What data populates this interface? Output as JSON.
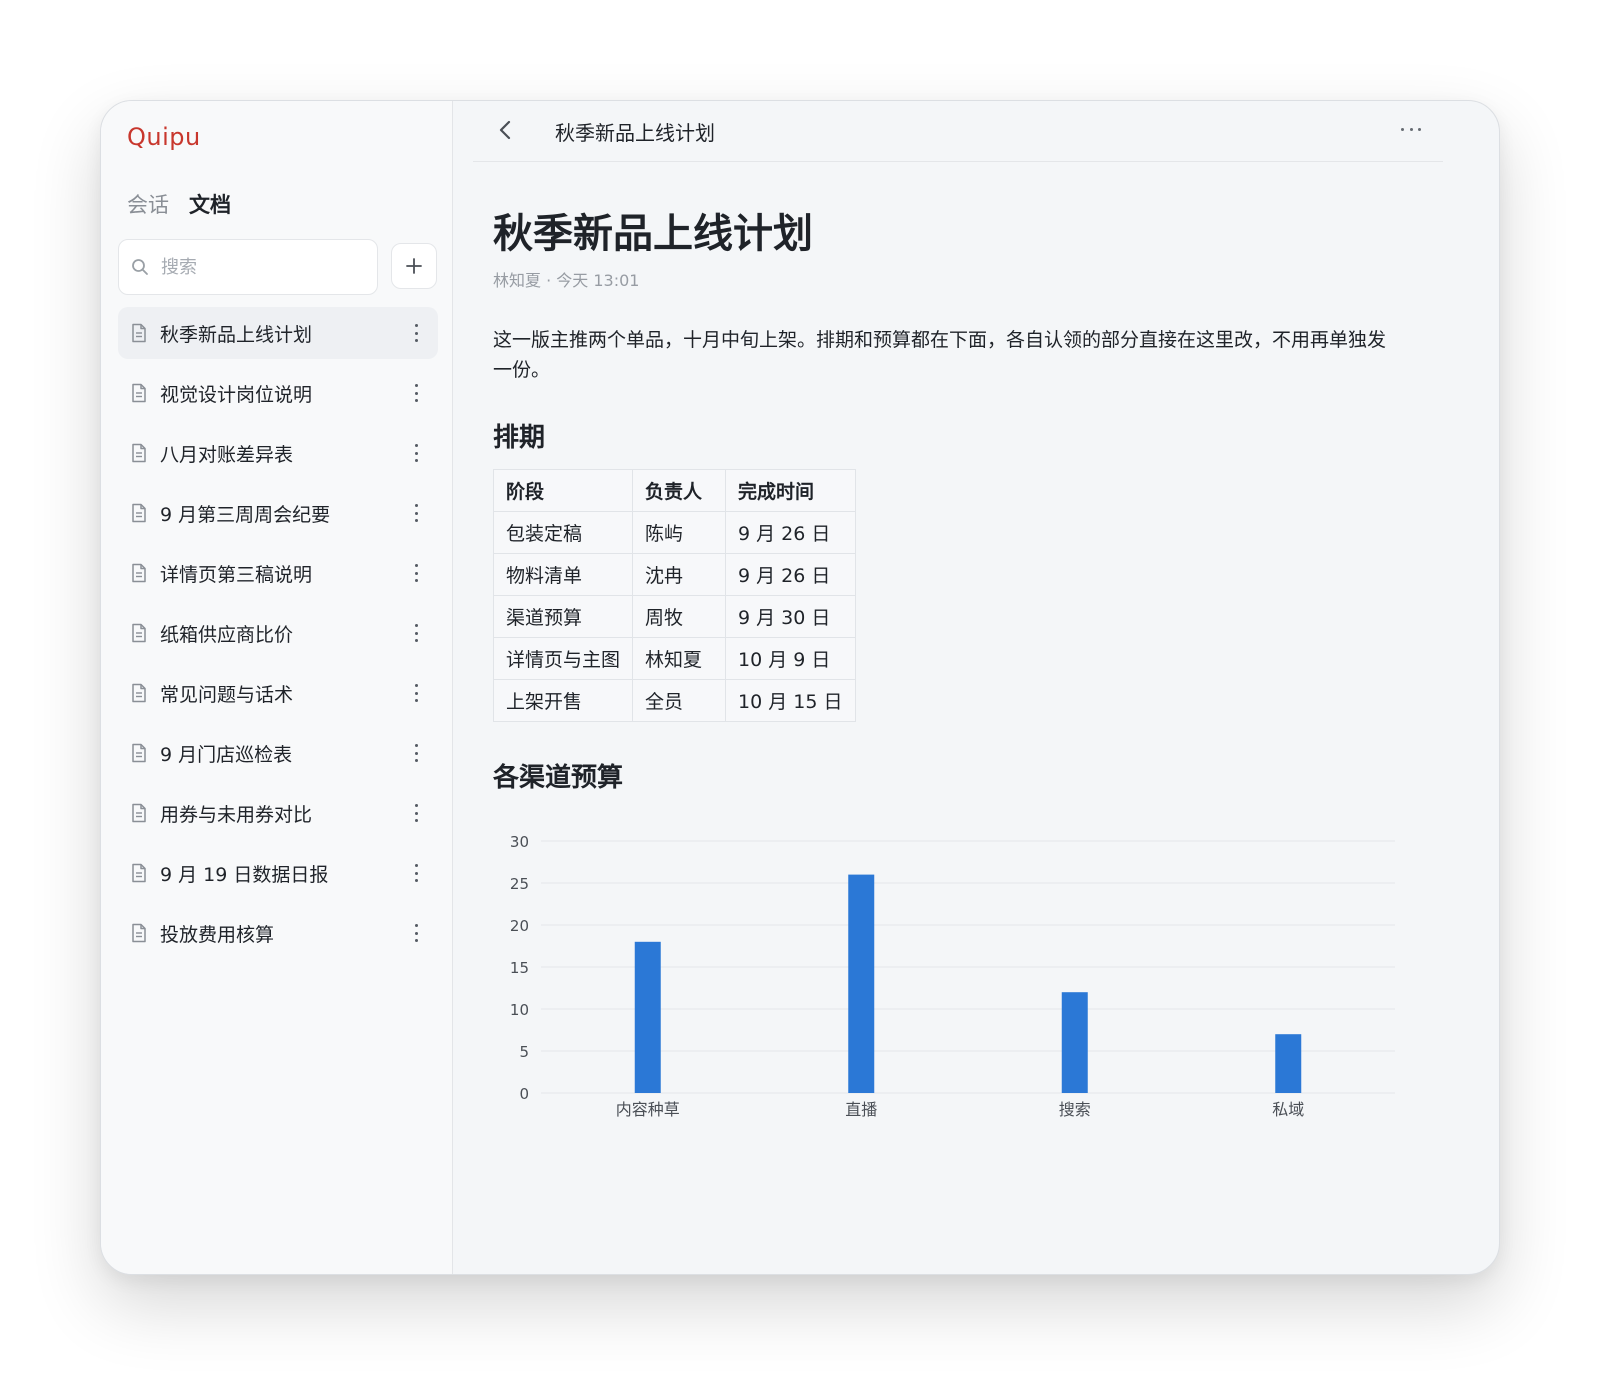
{
  "app": {
    "logo": "Quipu"
  },
  "sidebar": {
    "mode_tabs": [
      "会话",
      "文档"
    ],
    "active_mode": "文档",
    "search": {
      "placeholder": "搜索",
      "value": ""
    },
    "documents": [
      "秋季新品上线计划",
      "视觉设计岗位说明",
      "八月对账差异表",
      "9 月第三周周会纪要",
      "详情页第三稿说明",
      "纸箱供应商比价",
      "常见问题与话术",
      "9 月门店巡检表",
      "用券与未用券对比",
      "9 月 19 日数据日报",
      "投放费用核算"
    ],
    "active_document": "秋季新品上线计划"
  },
  "topbar": {
    "title": "秋季新品上线计划"
  },
  "doc": {
    "title": "秋季新品上线计划",
    "meta": "林知夏 · 今天 13:01",
    "intro": "这一版主推两个单品，十月中旬上架。排期和预算都在下面，各自认领的部分直接在这里改，不用再单独发一份。",
    "schedule_heading": "排期",
    "schedule": {
      "headers": [
        "阶段",
        "负责人",
        "完成时间"
      ],
      "rows": [
        [
          "包装定稿",
          "陈屿",
          "9 月 26 日"
        ],
        [
          "物料清单",
          "沈冉",
          "9 月 26 日"
        ],
        [
          "渠道预算",
          "周牧",
          "9 月 30 日"
        ],
        [
          "详情页与主图",
          "林知夏",
          "10 月 9 日"
        ],
        [
          "上架开售",
          "全员",
          "10 月 15 日"
        ]
      ]
    },
    "budget_heading": "各渠道预算"
  },
  "colors": {
    "accent": "#c8372d",
    "bar": "#2b78d6"
  },
  "chart_data": {
    "type": "bar",
    "categories": [
      "内容种草",
      "直播",
      "搜索",
      "私域"
    ],
    "values": [
      18,
      26,
      12,
      7
    ],
    "ylim": [
      0,
      30
    ],
    "yticks": [
      0,
      5,
      10,
      15,
      20,
      25,
      30
    ],
    "grid": true
  }
}
